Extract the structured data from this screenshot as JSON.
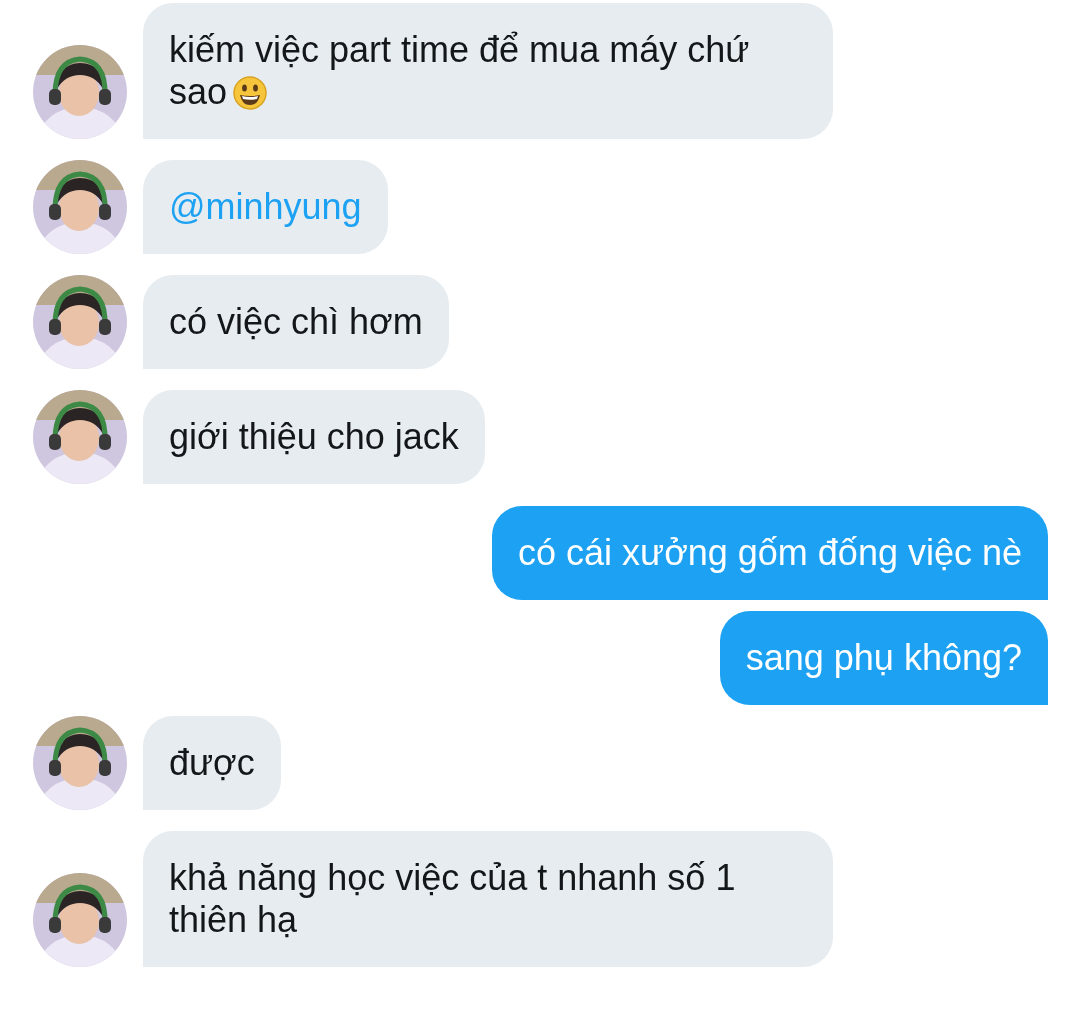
{
  "messages": [
    {
      "outgoing": false,
      "kind": "text",
      "text": "kiếm việc part time để mua máy chứ sao",
      "has_emoji": true
    },
    {
      "outgoing": false,
      "kind": "mention",
      "text": "@minhyung"
    },
    {
      "outgoing": false,
      "kind": "text",
      "text": "có việc chì hơm"
    },
    {
      "outgoing": false,
      "kind": "text",
      "text": "giới thiệu cho jack"
    },
    {
      "outgoing": true,
      "kind": "text",
      "text": "có cái xưởng gốm đống việc nè"
    },
    {
      "outgoing": true,
      "kind": "text",
      "text": "sang phụ không?"
    },
    {
      "outgoing": false,
      "kind": "text",
      "text": "được"
    },
    {
      "outgoing": false,
      "kind": "text",
      "text": "khả năng học việc của t nhanh số 1 thiên hạ"
    }
  ]
}
